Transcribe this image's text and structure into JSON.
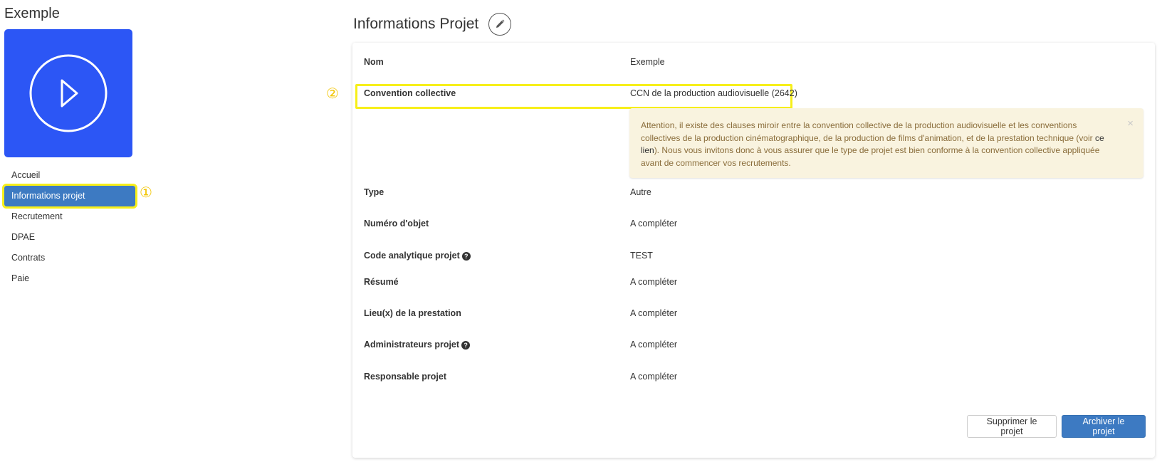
{
  "project": {
    "name": "Exemple"
  },
  "sidebar": {
    "items": [
      {
        "label": "Accueil"
      },
      {
        "label": "Informations projet"
      },
      {
        "label": "Recrutement"
      },
      {
        "label": "DPAE"
      },
      {
        "label": "Contrats"
      },
      {
        "label": "Paie"
      }
    ],
    "active_index": 1,
    "marker": "①"
  },
  "main": {
    "title": "Informations Projet",
    "marker": "②",
    "rows": {
      "nom": {
        "label": "Nom",
        "value": "Exemple"
      },
      "convention": {
        "label": "Convention collective",
        "value": "CCN de la production audiovisuelle (2642)"
      },
      "type": {
        "label": "Type",
        "value": "Autre"
      },
      "numero": {
        "label": "Numéro d'objet",
        "value": "A compléter"
      },
      "code": {
        "label": "Code analytique projet",
        "value": "TEST"
      },
      "resume": {
        "label": "Résumé",
        "value": "A compléter"
      },
      "lieux": {
        "label": "Lieu(x) de la prestation",
        "value": "A compléter"
      },
      "admins": {
        "label": "Administrateurs projet",
        "value": "A compléter"
      },
      "responsable": {
        "label": "Responsable projet",
        "value": "A compléter"
      }
    },
    "alert": {
      "text_before": "Attention, il existe des clauses miroir entre la convention collective de la production audiovisuelle et les conventions collectives de la production cinématographique, de la production de films d'animation, et de la prestation technique (voir ",
      "link": "ce lien",
      "text_after": "). Nous vous invitons donc à vous assurer que le type de projet est bien conforme à la convention collective appliquée avant de commencer vos recrutements.",
      "close": "×"
    },
    "help_glyph": "?",
    "buttons": {
      "delete": "Supprimer le projet",
      "archive": "Archiver le projet"
    }
  },
  "colors": {
    "tile": "#2c56f5",
    "primary": "#3d7ac2",
    "highlight": "#f7ef1a",
    "marker": "#f2c500",
    "alert_bg": "#f9f3df",
    "alert_text": "#8a6d3b"
  },
  "icons": {
    "tile": "play-circle-icon",
    "edit": "pencil-icon",
    "help": "question-circle-icon",
    "close": "close-icon"
  }
}
